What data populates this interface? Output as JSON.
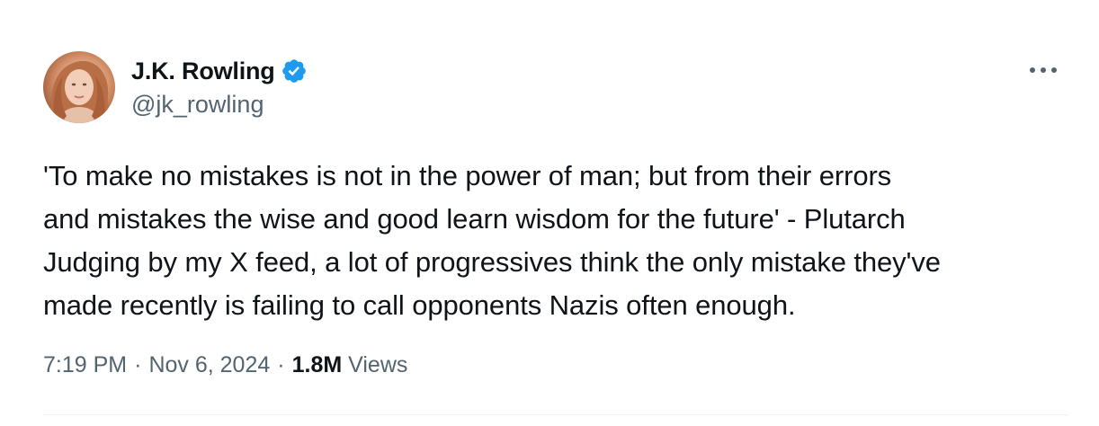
{
  "author": {
    "display_name": "J.K. Rowling",
    "handle": "@jk_rowling",
    "verified": true,
    "verified_color": "#1d9bf0",
    "avatar_icon": "profile-photo"
  },
  "more_icon": "more-options-icon",
  "tweet": {
    "text": "'To make no mistakes is not in the power of man; but from their errors\nand mistakes the wise and good learn wisdom for the future' - Plutarch\nJudging by my X feed, a lot of progressives think the only mistake they've\nmade recently is failing to call opponents Nazis often enough."
  },
  "meta": {
    "time": "7:19 PM",
    "date": "Nov 6, 2024",
    "separator": "·",
    "views_count": "1.8M",
    "views_label": "Views"
  },
  "colors": {
    "text_primary": "#0f1419",
    "text_secondary": "#536471",
    "divider": "#eff3f4"
  }
}
